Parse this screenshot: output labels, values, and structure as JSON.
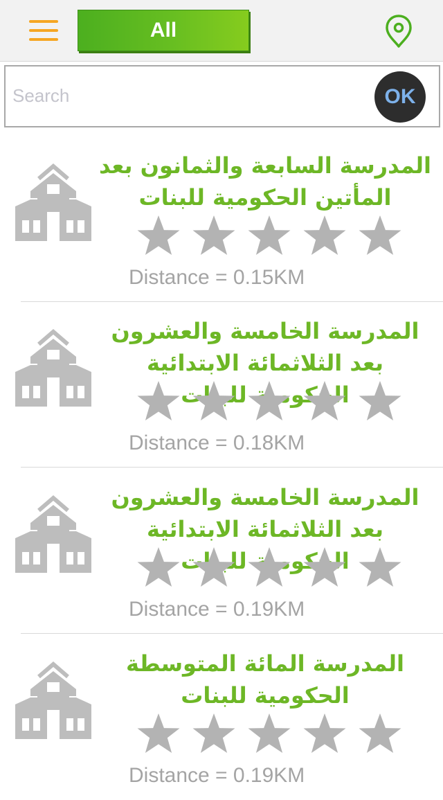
{
  "header": {
    "menu_icon": "hamburger-icon",
    "filter_label": "All",
    "location_icon": "map-pin-icon",
    "accent_color": "#6db726",
    "menu_color": "#f5a623"
  },
  "search": {
    "placeholder": "Search",
    "value": "",
    "ok_label": "OK"
  },
  "schools": [
    {
      "name": "المدرسة السابعة والثمانون بعد المأتين الحكومية للبنات",
      "distance": "Distance = 0.15KM",
      "rating": 0,
      "max_rating": 5,
      "icon": "school-building-icon"
    },
    {
      "name": "المدرسة الخامسة والعشرون بعد الثلاثمائة الابتدائية الحكومية للبنات",
      "distance": "Distance = 0.18KM",
      "rating": 0,
      "max_rating": 5,
      "icon": "school-building-icon"
    },
    {
      "name": "المدرسة الخامسة والعشرون بعد الثلاثمائة الابتدائية الحكومية للبنات",
      "distance": "Distance = 0.19KM",
      "rating": 0,
      "max_rating": 5,
      "icon": "school-building-icon"
    },
    {
      "name": "المدرسة المائة المتوسطة الحكومية للبنات",
      "distance": "Distance = 0.19KM",
      "rating": 0,
      "max_rating": 5,
      "icon": "school-building-icon"
    }
  ]
}
